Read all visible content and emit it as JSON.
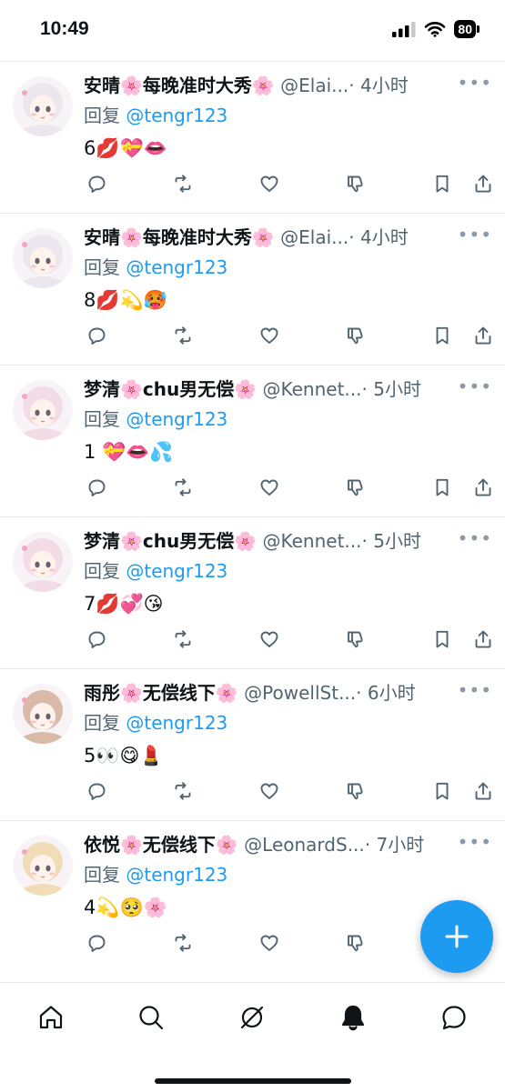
{
  "status_bar": {
    "time": "10:49",
    "battery": "80"
  },
  "colors": {
    "accent": "#1d9bf0",
    "text": "#0f1419",
    "secondary": "#536471",
    "divider": "#e6e9eb"
  },
  "tweets": [
    {
      "name": "安晴🌸每晚准时大秀🌸",
      "handle": "@Elai...",
      "time": "· 4小时",
      "reply_prefix": "回复",
      "reply_to": "@tengr123",
      "body": "6💋💝👄",
      "avatar_hair": "#ece6ee"
    },
    {
      "name": "安晴🌸每晚准时大秀🌸",
      "handle": "@Elai...",
      "time": "· 4小时",
      "reply_prefix": "回复",
      "reply_to": "@tengr123",
      "body": "8💋💫🥵",
      "avatar_hair": "#ece6ee"
    },
    {
      "name": "梦清🌸chu男无偿🌸",
      "handle": "@Kennet...",
      "time": "· 5小时",
      "reply_prefix": "回复",
      "reply_to": "@tengr123",
      "body": " 1 💝👄💦",
      "avatar_hair": "#f4dce6"
    },
    {
      "name": "梦清🌸chu男无偿🌸",
      "handle": "@Kennet...",
      "time": "· 5小时",
      "reply_prefix": "回复",
      "reply_to": "@tengr123",
      "body": "7💋💞😘",
      "avatar_hair": "#f4dce6"
    },
    {
      "name": "雨彤🌸无偿线下🌸",
      "handle": "@PowellSt...",
      "time": "· 6小时",
      "reply_prefix": "回复",
      "reply_to": "@tengr123",
      "body": "5👀😋💄",
      "avatar_hair": "#d9b9a8"
    },
    {
      "name": "依悦🌸无偿线下🌸",
      "handle": "@LeonardS...",
      "time": "· 7小时",
      "reply_prefix": "回复",
      "reply_to": "@tengr123",
      "body": "4💫🥺🌸",
      "avatar_hair": "#f2dcb8"
    }
  ],
  "icons": {
    "more": "more-icon",
    "actions": [
      "reply-icon",
      "retweet-icon",
      "like-icon",
      "dislike-icon",
      "bookmark-icon",
      "share-icon"
    ],
    "nav": [
      "home-icon",
      "search-icon",
      "grok-icon",
      "notifications-icon",
      "messages-icon"
    ],
    "fab": "compose-plus-icon"
  }
}
